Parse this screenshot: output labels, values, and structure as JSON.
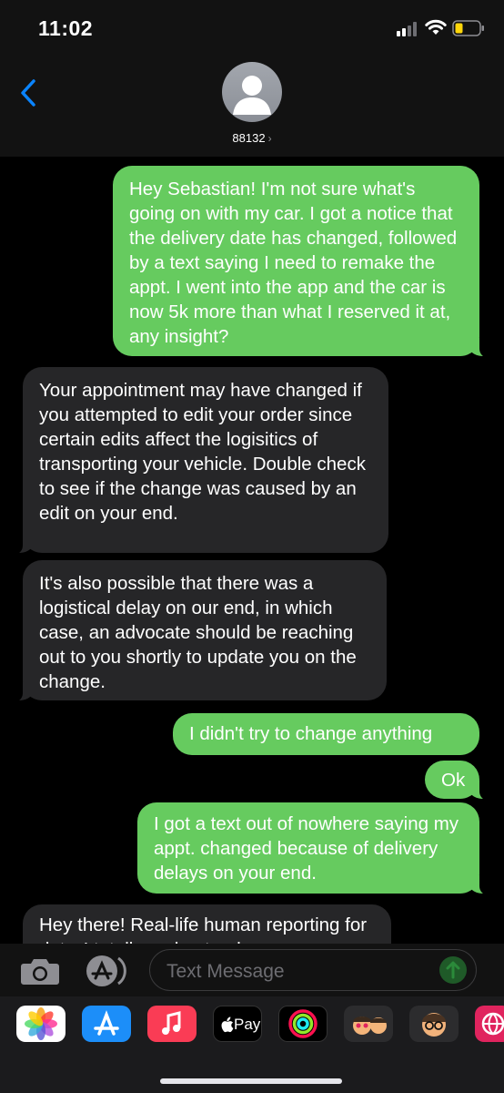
{
  "status_bar": {
    "time": "11:02"
  },
  "header": {
    "contact_name": "88132",
    "chevron": "›"
  },
  "messages": [
    {
      "direction": "outgoing",
      "text": "Hey Sebastian! I'm not sure what's going on with my car. I got a notice that the delivery date has changed, followed by a text saying I need to remake the appt. I went into the app and the car is now 5k more than what I reserved it at, any insight?"
    },
    {
      "direction": "incoming",
      "text": "Your appointment may have changed if you attempted to edit your order since certain edits affect the logisitics of transporting your vehicle. Double check to see if the change was caused by an edit on your end."
    },
    {
      "direction": "incoming",
      "text": "It's also possible that there was a logistical delay on our end, in which case, an advocate should be reaching out to you shortly to update you on the change."
    },
    {
      "direction": "outgoing",
      "text": "I didn't try to change anything"
    },
    {
      "direction": "outgoing",
      "text": "Ok"
    },
    {
      "direction": "outgoing",
      "text": "I got a text out of nowhere saying my appt. changed because of delivery delays on your end."
    },
    {
      "direction": "incoming",
      "text": "Hey there! Real-life human reporting for duty. I totally understand"
    }
  ],
  "input": {
    "placeholder": "Text Message"
  },
  "drawer": {
    "apps": [
      "photos-icon",
      "app-store-icon",
      "music-icon",
      "apple-pay-icon",
      "activity-icon",
      "memoji-stickers-icon",
      "memoji-icon",
      "web-icon"
    ],
    "apple_pay_label": "Pay"
  },
  "colors": {
    "outgoing": "#66cb5f",
    "incoming": "#262628",
    "accent": "#0a84ff"
  }
}
